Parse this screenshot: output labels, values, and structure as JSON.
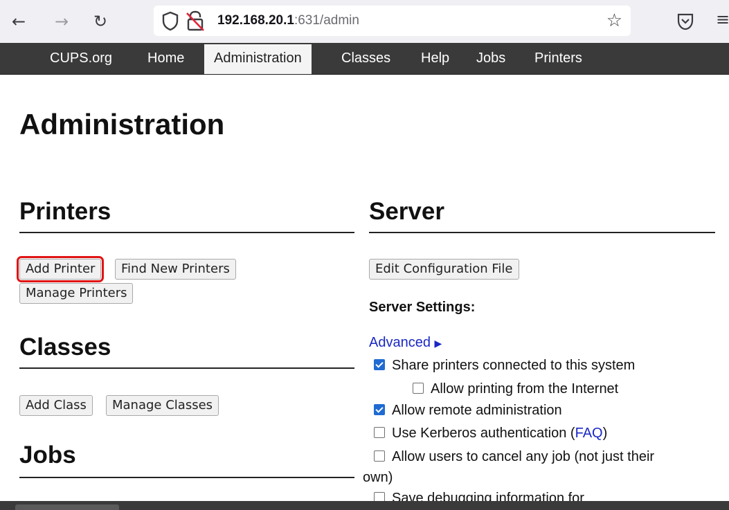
{
  "browser": {
    "url_host": "192.168.20.1",
    "url_rest": ":631/admin",
    "icons": [
      "back-icon",
      "forward-icon",
      "reload-icon",
      "shield-icon",
      "lock-warning-icon",
      "star-icon",
      "pocket-icon",
      "menu-icon"
    ]
  },
  "nav": {
    "items": [
      "CUPS.org",
      "Home",
      "Administration",
      "Classes",
      "Help",
      "Jobs",
      "Printers"
    ],
    "active": "Administration"
  },
  "page": {
    "title": "Administration"
  },
  "printers": {
    "heading": "Printers",
    "add_printer": "Add Printer",
    "find_new_printers": "Find New Printers",
    "manage_printers": "Manage Printers"
  },
  "classes": {
    "heading": "Classes",
    "add_class": "Add Class",
    "manage_classes": "Manage Classes"
  },
  "jobs": {
    "heading": "Jobs"
  },
  "server": {
    "heading": "Server",
    "edit_config": "Edit Configuration File",
    "settings_label": "Server Settings:",
    "advanced": "Advanced",
    "options": [
      {
        "label": "Share printers connected to this system",
        "checked": true
      },
      {
        "label": "Allow printing from the Internet",
        "checked": false
      },
      {
        "label": "Allow remote administration",
        "checked": true
      },
      {
        "label": "Use Kerberos authentication (",
        "link": "FAQ",
        "suffix": ")",
        "checked": false
      },
      {
        "label": "Allow users to cancel any job (not just their",
        "continuation": "own)",
        "checked": false
      },
      {
        "label": "Save debugging information for",
        "checked": false
      }
    ]
  },
  "colors": {
    "nav_bg": "#3a3a3a",
    "link": "#1a28c4",
    "checkbox_on": "#1f6bd2",
    "highlight": "#e01414"
  }
}
